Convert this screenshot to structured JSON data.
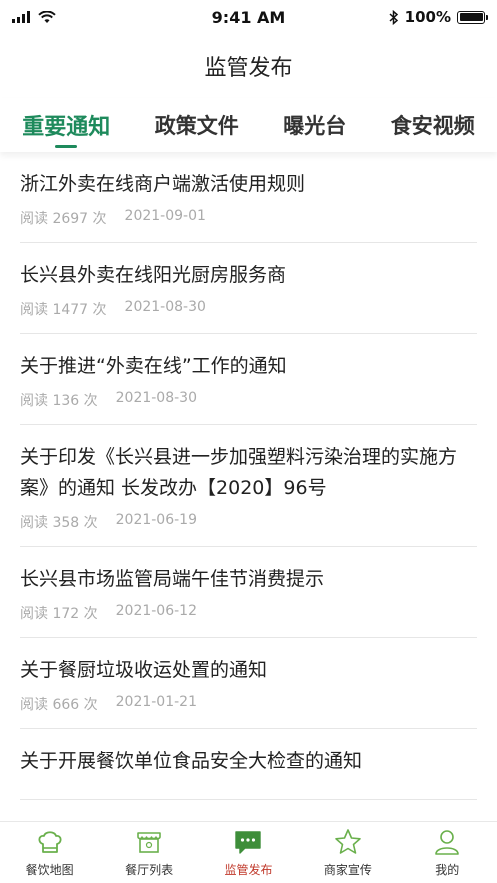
{
  "status": {
    "time": "9:41 AM",
    "battery": "100%"
  },
  "header": {
    "title": "监管发布"
  },
  "tabs": [
    {
      "label": "重要通知",
      "active": true
    },
    {
      "label": "政策文件",
      "active": false
    },
    {
      "label": "曝光台",
      "active": false
    },
    {
      "label": "食安视频",
      "active": false
    }
  ],
  "items": [
    {
      "title": "浙江外卖在线商户端激活使用规则",
      "reads": "阅读 2697 次",
      "date": "2021-09-01"
    },
    {
      "title": "长兴县外卖在线阳光厨房服务商",
      "reads": "阅读 1477 次",
      "date": "2021-08-30"
    },
    {
      "title": "关于推进“外卖在线”工作的通知",
      "reads": "阅读 136 次",
      "date": "2021-08-30"
    },
    {
      "title": "关于印发《长兴县进一步加强塑料污染治理的实施方案》的通知 长发改办【2020】96号",
      "reads": "阅读 358 次",
      "date": "2021-06-19"
    },
    {
      "title": "长兴县市场监管局端午佳节消费提示",
      "reads": "阅读 172 次",
      "date": "2021-06-12"
    },
    {
      "title": "关于餐厨垃圾收运处置的通知",
      "reads": "阅读 666 次",
      "date": "2021-01-21"
    },
    {
      "title": "关于开展餐饮单位食品安全大检查的通知",
      "reads": "",
      "date": ""
    }
  ],
  "bottom_nav": [
    {
      "label": "餐饮地图",
      "icon": "chef-hat-icon"
    },
    {
      "label": "餐厅列表",
      "icon": "shop-icon"
    },
    {
      "label": "监管发布",
      "icon": "message-icon",
      "active": true
    },
    {
      "label": "商家宣传",
      "icon": "star-icon"
    },
    {
      "label": "我的",
      "icon": "user-icon"
    }
  ],
  "colors": {
    "accent": "#1e8a5c",
    "icon_green": "#6ab04c",
    "active_nav": "#c0392b"
  }
}
